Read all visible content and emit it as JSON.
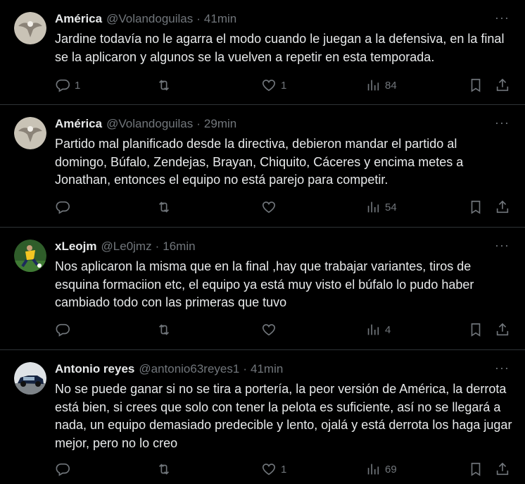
{
  "tweets": [
    {
      "name": "América",
      "handle": "@Volandoguilas",
      "separator": "·",
      "time": "41min",
      "text": "Jardine todavía no le agarra el modo cuando le juegan a la defensiva, en la final se la aplicaron y algunos se la vuelven a repetir en esta temporada.",
      "replies": "1",
      "retweets": "",
      "likes": "1",
      "views": "84",
      "avatar": "eagle-avatar"
    },
    {
      "name": "América",
      "handle": "@Volandoguilas",
      "separator": "·",
      "time": "29min",
      "text": "Partido mal planificado desde la directiva, debieron mandar el partido al domingo, Búfalo, Zendejas, Brayan, Chiquito, Cáceres y encima metes a Jonathan, entonces el equipo no está parejo para competir.",
      "replies": "",
      "retweets": "",
      "likes": "",
      "views": "54",
      "avatar": "eagle-avatar"
    },
    {
      "name": "xLeojm",
      "handle": "@Le0jmz",
      "separator": "·",
      "time": "16min",
      "text": "Nos aplicaron la misma que en la final ,hay que trabajar variantes, tiros de esquina formaciion etc, el equipo ya está muy  visto el búfalo lo pudo haber cambiado todo con las primeras que tuvo",
      "replies": "",
      "retweets": "",
      "likes": "",
      "views": "4",
      "avatar": "soccer-player-avatar"
    },
    {
      "name": "Antonio reyes",
      "handle": "@antonio63reyes1",
      "separator": "·",
      "time": "41min",
      "text": "No se puede ganar si no se tira a portería, la peor versión de América, la derrota está bien, si crees que solo con tener la pelota es suficiente, así no se llegará a nada, un equipo demasiado predecible y lento, ojalá y está derrota los haga jugar mejor, pero no lo creo",
      "replies": "",
      "retweets": "",
      "likes": "1",
      "views": "69",
      "avatar": "car-avatar"
    }
  ],
  "more_label": "···",
  "colors": {
    "background": "#000000",
    "text": "#e7e9ea",
    "muted": "#71767b",
    "divider": "#2f3336"
  }
}
